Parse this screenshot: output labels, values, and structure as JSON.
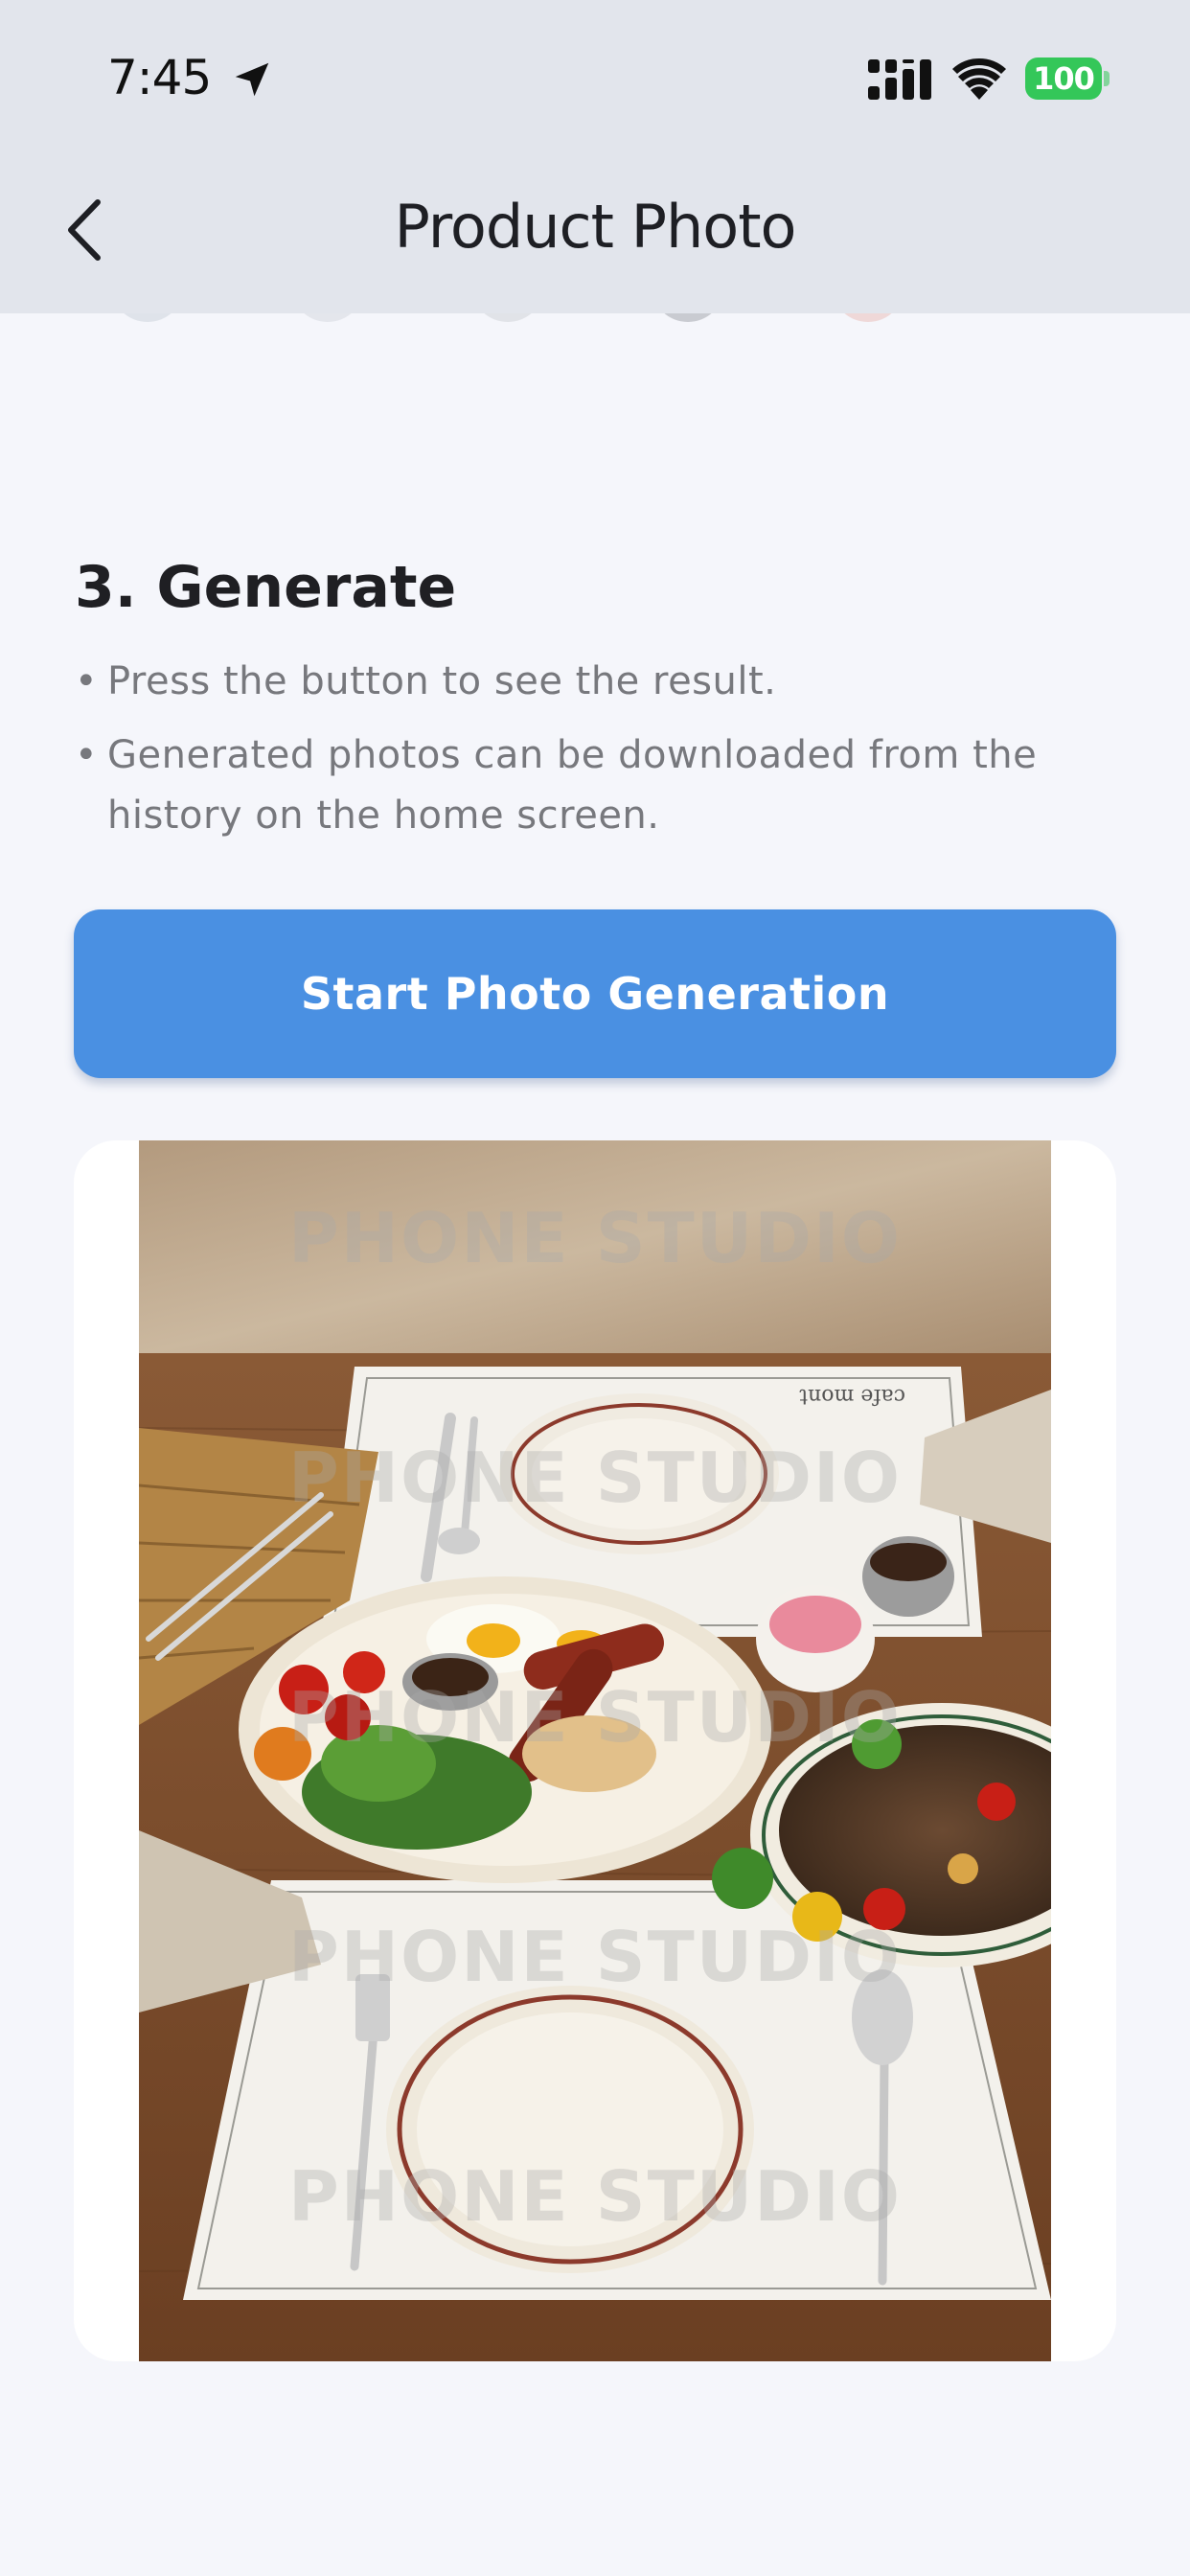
{
  "status_bar": {
    "time": "7:45",
    "battery": "100"
  },
  "header": {
    "title": "Product Photo"
  },
  "section": {
    "title": "3. Generate",
    "bullets": [
      {
        "dot": "•",
        "text": "Press the button to see the result."
      },
      {
        "dot": "•",
        "text": "Generated photos can be downloaded from the history on the home screen."
      }
    ]
  },
  "cta": {
    "label": "Start Photo Generation"
  },
  "photo": {
    "watermark": "PHONE STUDIO",
    "menu_brand": "cafe mont"
  },
  "colors": {
    "accent": "#4a90e2",
    "header_bg": "#e2e5ec",
    "page_bg": "#f5f6fb",
    "battery": "#34c759"
  }
}
